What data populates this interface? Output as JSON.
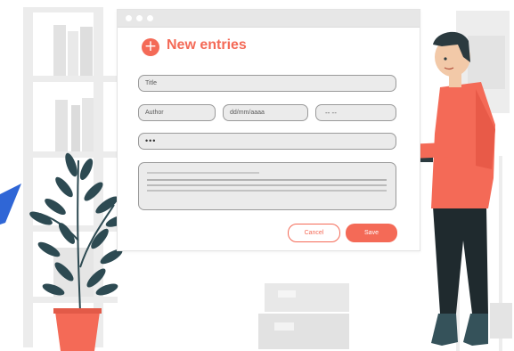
{
  "window": {
    "heading": "New entries",
    "add_icon": "+",
    "fields": {
      "title_placeholder": "Title",
      "author_placeholder": "Author",
      "date_placeholder": "dd/mm/aaaa",
      "time_placeholder": "-- --",
      "password_value": "•••"
    },
    "buttons": {
      "cancel": "Cancel",
      "save": "Save"
    }
  },
  "colors": {
    "accent": "#f46a57",
    "field_bg": "#ebebeb",
    "plant_leaf": "#2d4a52",
    "pot": "#f46a57",
    "shirt": "#f46a57",
    "trousers": "#1f2a2e",
    "blue_accent": "#2f66d6"
  },
  "icons": [
    "plus-icon",
    "window-dot-icon"
  ]
}
